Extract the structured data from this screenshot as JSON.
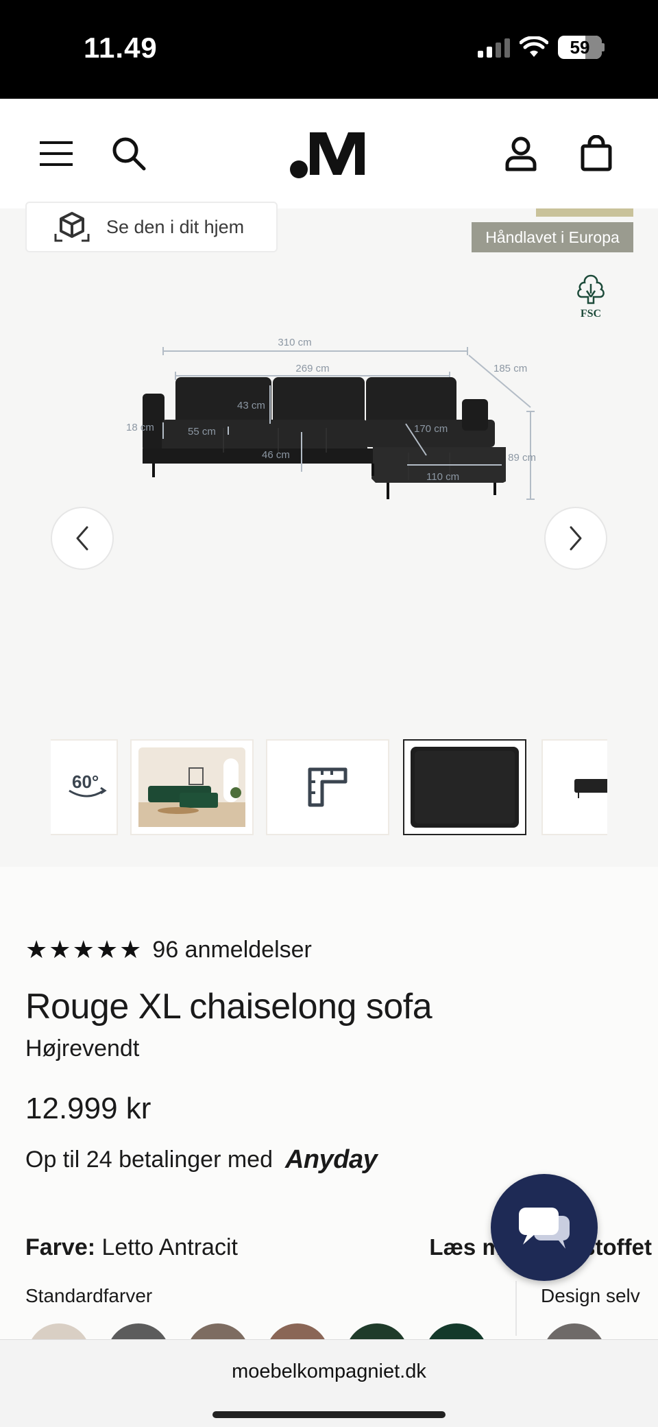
{
  "status_bar": {
    "time": "11.49",
    "battery": "59"
  },
  "header": {
    "logo": ".M"
  },
  "gallery": {
    "ar_button_label": "Se den i dit hjem",
    "badge_handmade": "Håndlavet i Europa",
    "fsc_label": "FSC",
    "dimensions": {
      "total_width": "310 cm",
      "back_width": "269 cm",
      "depth": "185 cm",
      "back_cushion_height": "43 cm",
      "armrest": "18 cm",
      "seat_depth": "55 cm",
      "seat_height": "46 cm",
      "chaise_length": "170 cm",
      "chaise_width": "110 cm",
      "height": "89 cm"
    },
    "thumbnails": [
      "360-view",
      "living-room-photo",
      "measurements-icon",
      "fabric-swatch",
      "side-view-photo"
    ],
    "selected_thumbnail": 3
  },
  "product": {
    "rating_stars": 5,
    "reviews": "96 anmeldelser",
    "title": "Rouge XL chaiselong sofa",
    "variant": "Højrevendt",
    "price": "12.999 kr",
    "payments_text": "Op til 24 betalinger med",
    "payments_provider": "Anyday",
    "color_label": "Farve:",
    "color_value": "Letto Antracit",
    "read_more": "Læs mere om stoffet",
    "standard_colors_label": "Standardfarver",
    "design_label": "Design selv"
  },
  "colors": {
    "swatches": [
      "#d9cfc4",
      "#5c5c5c",
      "#7d6c61",
      "#8a6656",
      "#1f3b2a",
      "#143a2b",
      "#6e6a68"
    ],
    "chat_bg": "#1e2a55"
  },
  "browser": {
    "url": "moebelkompagniet.dk"
  }
}
